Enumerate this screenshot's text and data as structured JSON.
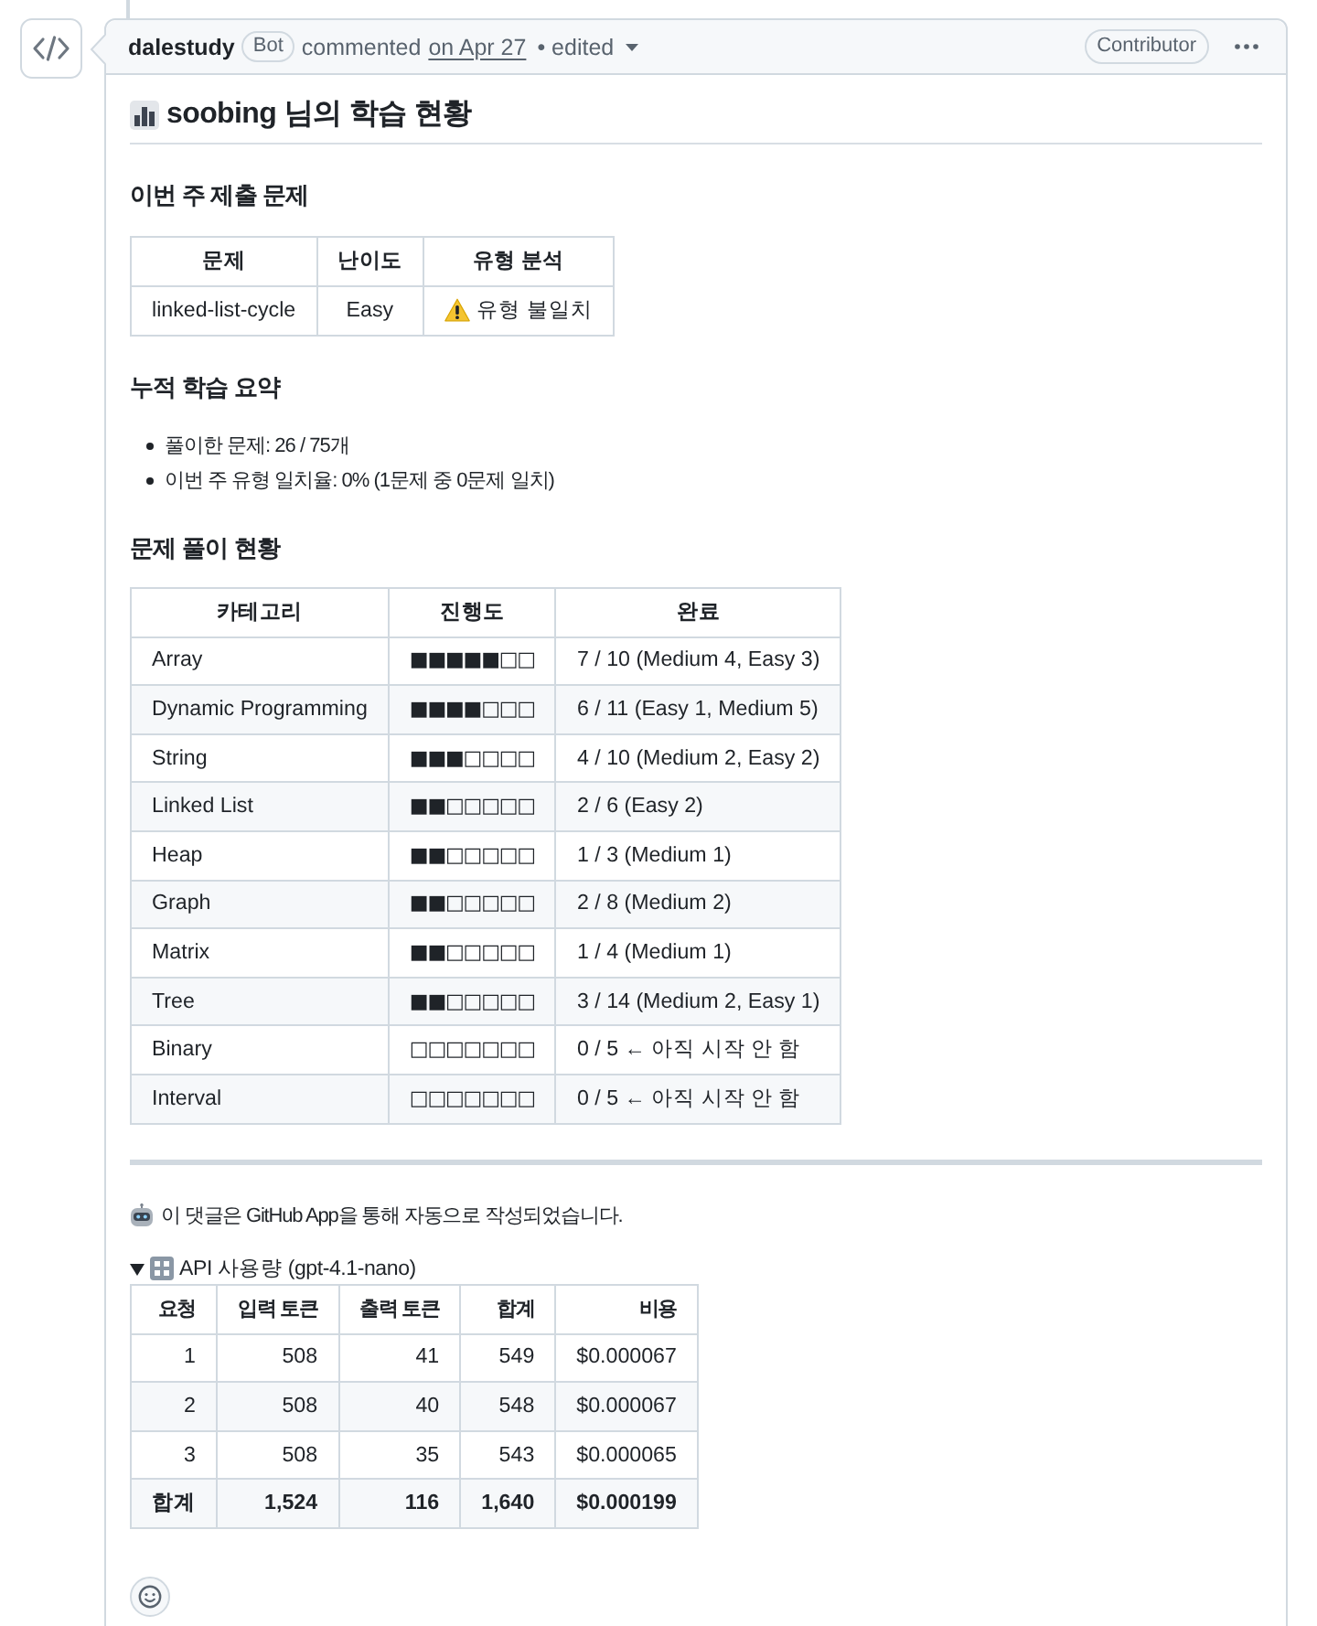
{
  "comment": {
    "author": "dalestudy",
    "author_badge": "Bot",
    "action": "commented",
    "date": "on Apr 27",
    "edited": "• edited",
    "role_badge": "Contributor"
  },
  "title": {
    "text": "soobing 님의 학습 현황"
  },
  "submitted": {
    "heading": "이번 주 제출 문제",
    "columns": [
      "문제",
      "난이도",
      "유형 분석"
    ],
    "rows": [
      {
        "cells": [
          "linked-list-cycle",
          "Easy",
          "유형 불일치"
        ],
        "warning": true
      }
    ]
  },
  "summary": {
    "heading": "누적 학습 요약",
    "items": [
      "풀이한 문제: 26 / 75개",
      "이번 주 유형 일치율: 0% (1문제 중 0문제 일치)"
    ]
  },
  "progress": {
    "heading": "문제 풀이 현황",
    "columns": [
      "카테고리",
      "진행도",
      "완료"
    ],
    "rows": [
      [
        "Array",
        "■■■■■□□",
        "7 / 10 (Medium 4, Easy 3)"
      ],
      [
        "Dynamic Programming",
        "■■■■□□□",
        "6 / 11 (Easy 1, Medium 5)"
      ],
      [
        "String",
        "■■■□□□□",
        "4 / 10 (Medium 2, Easy 2)"
      ],
      [
        "Linked List",
        "■■□□□□□",
        "2 / 6 (Easy 2)"
      ],
      [
        "Heap",
        "■■□□□□□",
        "1 / 3 (Medium 1)"
      ],
      [
        "Graph",
        "■■□□□□□",
        "2 / 8 (Medium 2)"
      ],
      [
        "Matrix",
        "■■□□□□□",
        "1 / 4 (Medium 1)"
      ],
      [
        "Tree",
        "■■□□□□□",
        "3 / 14 (Medium 2, Easy 1)"
      ],
      [
        "Binary",
        "□□□□□□□",
        "0 / 5 ← 아직 시작 안 함"
      ],
      [
        "Interval",
        "□□□□□□□",
        "0 / 5 ← 아직 시작 안 함"
      ]
    ]
  },
  "footer": {
    "note": "이 댓글은 GitHub App을 통해 자동으로 작성되었습니다.",
    "details": {
      "expanded": true,
      "summary": "API 사용량 (gpt-4.1-nano)",
      "columns": [
        "요청",
        "입력 토큰",
        "출력 토큰",
        "합계",
        "비용"
      ],
      "rows": [
        [
          "1",
          "508",
          "41",
          "549",
          "$0.000067"
        ],
        [
          "2",
          "508",
          "40",
          "548",
          "$0.000067"
        ],
        [
          "3",
          "508",
          "35",
          "543",
          "$0.000065"
        ]
      ],
      "total": [
        "합계",
        "1,524",
        "116",
        "1,640",
        "$0.000199"
      ]
    }
  }
}
